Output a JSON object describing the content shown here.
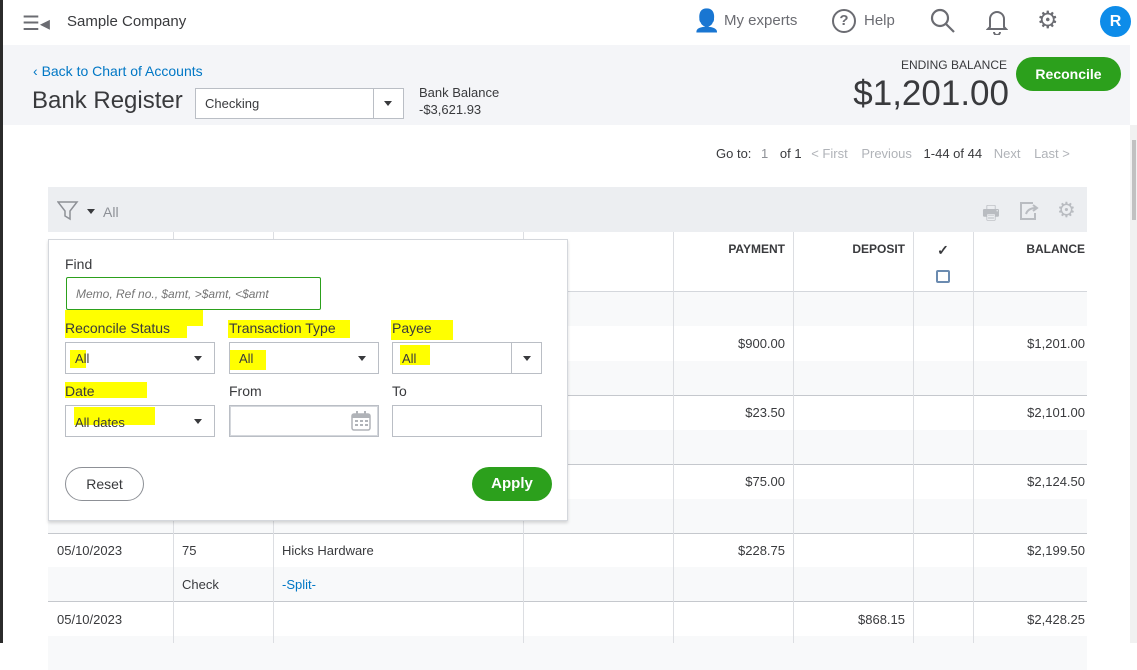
{
  "topbar": {
    "company": "Sample Company",
    "my_experts": "My experts",
    "help": "Help",
    "avatar": "R"
  },
  "pagehead": {
    "back_link": "Back to Chart of Accounts",
    "title": "Bank Register",
    "account": "Checking",
    "bank_balance_label": "Bank Balance",
    "bank_balance": "-$3,621.93",
    "ending_balance_label": "ENDING BALANCE",
    "ending_balance": "$1,201.00",
    "reconcile": "Reconcile"
  },
  "pagination": {
    "goto": "Go to:",
    "page": "1",
    "of_pages": "of 1",
    "first": "< First",
    "previous": "Previous",
    "range": "1-44 of 44",
    "next": "Next",
    "last": "Last >"
  },
  "toolbar": {
    "filter_value": "All"
  },
  "table": {
    "headers": {
      "memo_partial": ")",
      "payment": "PAYMENT",
      "deposit": "DEPOSIT",
      "check": "✓",
      "balance": "BALANCE"
    },
    "rows": [
      {
        "payment": "$900.00",
        "balance": "$1,201.00"
      },
      {
        "payment": "$23.50",
        "balance": "$2,101.00"
      },
      {
        "payment": "$75.00",
        "balance": "$2,124.50"
      },
      {
        "date": "05/10/2023",
        "ref": "75",
        "payee": "Hicks Hardware",
        "type": "Check",
        "account": "-Split-",
        "payment": "$228.75",
        "balance": "$2,199.50"
      },
      {
        "date": "05/10/2023",
        "deposit": "$868.15",
        "balance": "$2,428.25"
      }
    ]
  },
  "filter": {
    "find_label": "Find",
    "find_placeholder": "Memo, Ref no., $amt, >$amt, <$amt",
    "reconcile_label": "Reconcile Status",
    "reconcile_value": "All",
    "type_label": "Transaction Type",
    "type_value": "All",
    "payee_label": "Payee",
    "payee_value": "All",
    "date_label": "Date",
    "date_value": "All dates",
    "from_label": "From",
    "to_label": "To",
    "reset": "Reset",
    "apply": "Apply"
  },
  "colors": {
    "accent_green": "#2ca01c",
    "link_blue": "#0077c5",
    "highlight": "#ffff00"
  }
}
